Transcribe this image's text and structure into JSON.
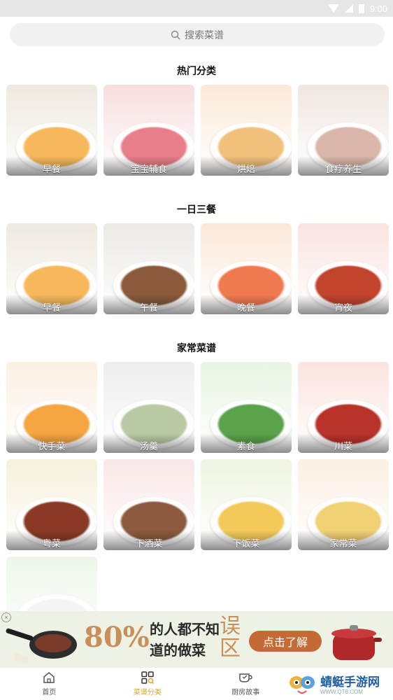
{
  "status_bar": {
    "time": "9:00"
  },
  "search": {
    "placeholder": "搜索菜谱"
  },
  "sections": [
    {
      "title": "热门分类",
      "items": [
        {
          "label": "早餐",
          "bg": "#eee9df",
          "plate": "#f6b85a"
        },
        {
          "label": "宝宝辅食",
          "bg": "#f7dede",
          "plate": "#e77e88"
        },
        {
          "label": "烘焙",
          "bg": "#fbe9d8",
          "plate": "#f1c07a"
        },
        {
          "label": "食疗养生",
          "bg": "#efe6e2",
          "plate": "#d9b6a8"
        }
      ]
    },
    {
      "title": "一日三餐",
      "items": [
        {
          "label": "早餐",
          "bg": "#eee9df",
          "plate": "#f6b85a"
        },
        {
          "label": "午餐",
          "bg": "#ece8e4",
          "plate": "#8a5a3a"
        },
        {
          "label": "晚餐",
          "bg": "#fbe8d8",
          "plate": "#f07a4f"
        },
        {
          "label": "宵夜",
          "bg": "#fae3df",
          "plate": "#c2442d"
        }
      ]
    },
    {
      "title": "家常菜谱",
      "items": [
        {
          "label": "快手菜",
          "bg": "#fbf0e2",
          "plate": "#f5a541"
        },
        {
          "label": "汤羹",
          "bg": "#ededed",
          "plate": "#b9c9a4"
        },
        {
          "label": "素食",
          "bg": "#e7f5e1",
          "plate": "#5aa34a"
        },
        {
          "label": "川菜",
          "bg": "#fae3df",
          "plate": "#b8332a"
        },
        {
          "label": "粤菜",
          "bg": "#f6f0dd",
          "plate": "#8a3a24"
        },
        {
          "label": "下酒菜",
          "bg": "#fae6e6",
          "plate": "#8c5a3e"
        },
        {
          "label": "下饭菜",
          "bg": "#eef5e0",
          "plate": "#f3c95a"
        },
        {
          "label": "家常菜",
          "bg": "#fbf0e2",
          "plate": "#f2d074"
        },
        {
          "label": "",
          "bg": "#eef6ea",
          "plate": "#f4f4f4"
        }
      ]
    }
  ],
  "ad": {
    "percent": "80%",
    "line1": "的人都不知",
    "line2": "道的做菜",
    "highlight_1": "误",
    "highlight_2": "区",
    "cta": "点击了解",
    "close": "×"
  },
  "tabs": [
    {
      "label": "首页",
      "icon": "home-icon"
    },
    {
      "label": "菜谱分类",
      "icon": "category-grid-icon",
      "active": true
    },
    {
      "label": "厨房故事",
      "icon": "cup-icon"
    },
    {
      "label": "",
      "icon": "profile-icon"
    }
  ],
  "watermark": {
    "text": "蜻蜓手游网",
    "url": "WWW.QT6.COM"
  },
  "colors": {
    "accent": "#e3a323",
    "ad_cta": "#c46a35",
    "ad_bg": "#eef2e4"
  }
}
